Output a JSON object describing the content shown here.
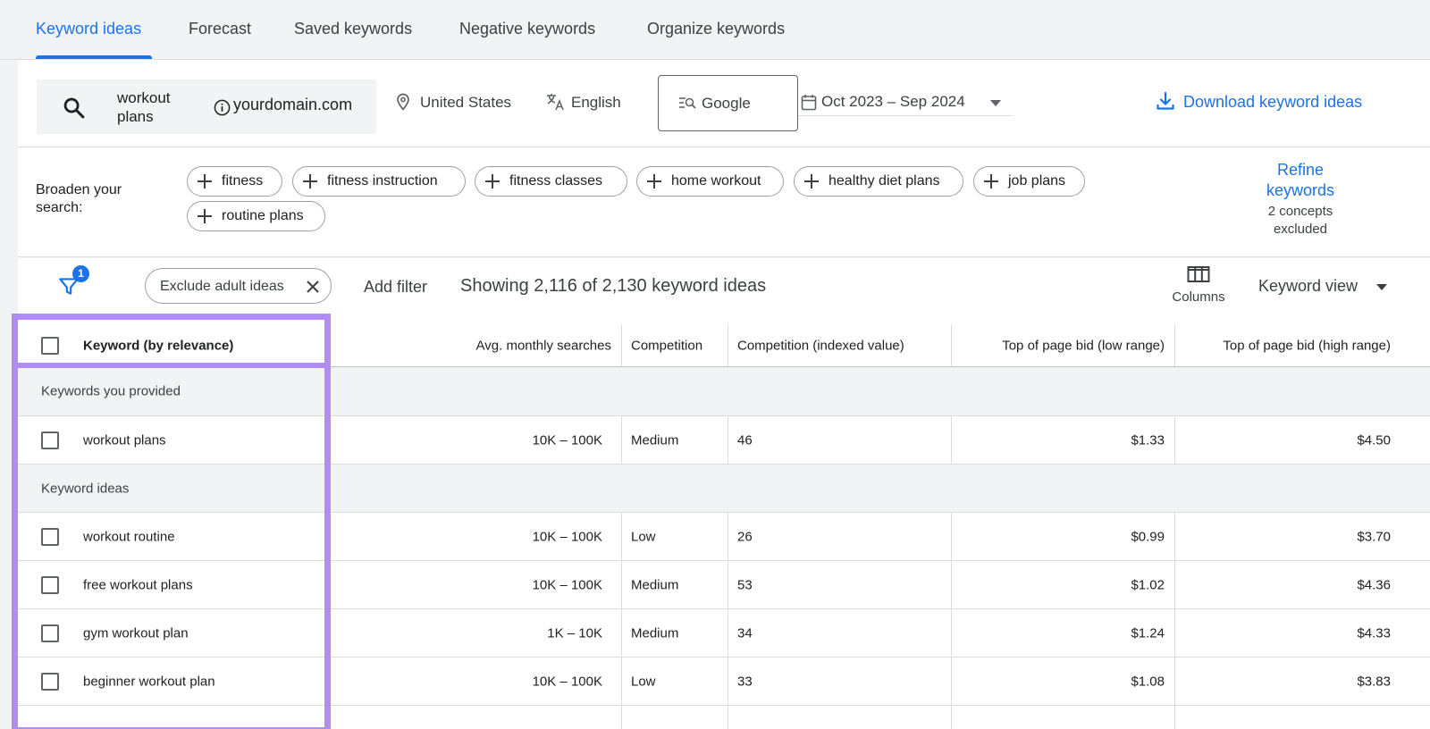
{
  "tabs": [
    {
      "label": "Keyword ideas",
      "active": true
    },
    {
      "label": "Forecast",
      "active": false
    },
    {
      "label": "Saved keywords",
      "active": false
    },
    {
      "label": "Negative keywords",
      "active": false
    },
    {
      "label": "Organize keywords",
      "active": false
    }
  ],
  "search": {
    "term": "workout plans",
    "domain": "yourdomain.com"
  },
  "location": "United States",
  "language": "English",
  "engine": "Google",
  "date_range": "Oct 2023 – Sep 2024",
  "download_label": "Download keyword ideas",
  "broaden": {
    "label": "Broaden your search:",
    "chips": [
      "fitness",
      "fitness instruction",
      "fitness classes",
      "home workout",
      "healthy diet plans",
      "job plans",
      "routine plans"
    ]
  },
  "refine": {
    "label": "Refine keywords",
    "sub": "2 concepts excluded"
  },
  "filters": {
    "count": "1",
    "chip": "Exclude adult ideas",
    "add_filter": "Add filter",
    "showing": "Showing 2,116 of 2,130 keyword ideas",
    "columns_label": "Columns",
    "view_label": "Keyword view"
  },
  "table": {
    "headers": {
      "keyword": "Keyword (by relevance)",
      "searches": "Avg. monthly searches",
      "competition": "Competition",
      "indexed": "Competition (indexed value)",
      "bid_low": "Top of page bid (low range)",
      "bid_high": "Top of page bid (high range)"
    },
    "groups": [
      {
        "label": "Keywords you provided",
        "rows": [
          {
            "keyword": "workout plans",
            "searches": "10K – 100K",
            "competition": "Medium",
            "indexed": "46",
            "bid_low": "$1.33",
            "bid_high": "$4.50"
          }
        ]
      },
      {
        "label": "Keyword ideas",
        "rows": [
          {
            "keyword": "workout routine",
            "searches": "10K – 100K",
            "competition": "Low",
            "indexed": "26",
            "bid_low": "$0.99",
            "bid_high": "$3.70"
          },
          {
            "keyword": "free workout plans",
            "searches": "10K – 100K",
            "competition": "Medium",
            "indexed": "53",
            "bid_low": "$1.02",
            "bid_high": "$4.36"
          },
          {
            "keyword": "gym workout plan",
            "searches": "1K – 10K",
            "competition": "Medium",
            "indexed": "34",
            "bid_low": "$1.24",
            "bid_high": "$4.33"
          },
          {
            "keyword": "beginner workout plan",
            "searches": "10K – 100K",
            "competition": "Low",
            "indexed": "33",
            "bid_low": "$1.08",
            "bid_high": "$3.83"
          }
        ]
      }
    ]
  },
  "colors": {
    "accent": "#1a73e8",
    "highlight": "#b18cf9"
  }
}
